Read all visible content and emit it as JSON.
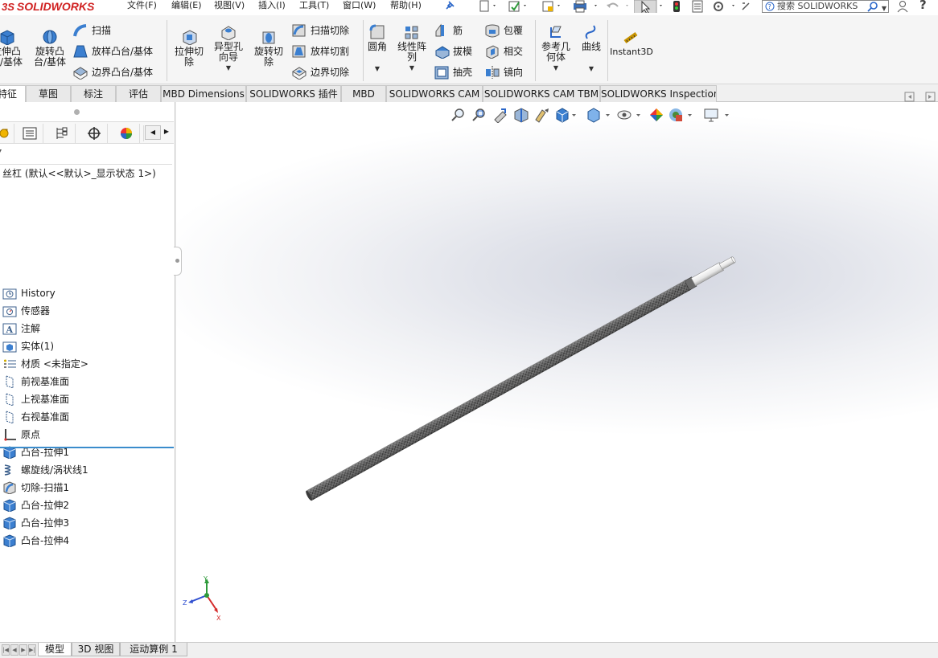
{
  "app": {
    "brand": "SOLIDWORKS",
    "brand_prefix": "3S"
  },
  "menu": [
    {
      "label": "文件(F)"
    },
    {
      "label": "编辑(E)"
    },
    {
      "label": "视图(V)"
    },
    {
      "label": "插入(I)"
    },
    {
      "label": "工具(T)"
    },
    {
      "label": "窗口(W)"
    },
    {
      "label": "帮助(H)"
    }
  ],
  "search": {
    "placeholder": "搜索 SOLIDWORKS"
  },
  "ribbon": {
    "extrude_boss": "拉伸凸\n台/基体",
    "revolve_boss": "旋转凸\n台/基体",
    "sweep": "扫描",
    "loft_boss": "放样凸台/基体",
    "boundary_boss": "边界凸台/基体",
    "extrude_cut": "拉伸切\n除",
    "hole_wizard": "异型孔\n向导",
    "revolve_cut": "旋转切\n除",
    "swept_cut": "扫描切除",
    "lofted_cut": "放样切割",
    "boundary_cut": "边界切除",
    "fillet": "圆角",
    "linear_pattern": "线性阵\n列",
    "rib": "筋",
    "draft": "拔模",
    "shell": "抽壳",
    "wrap": "包覆",
    "intersect": "相交",
    "mirror": "镜向",
    "ref_geometry": "参考几\n何体",
    "curves": "曲线",
    "instant3d": "Instant3D"
  },
  "tabs": [
    {
      "label": "特征",
      "active": true
    },
    {
      "label": "草图"
    },
    {
      "label": "标注"
    },
    {
      "label": "评估"
    },
    {
      "label": "MBD Dimensions"
    },
    {
      "label": "SOLIDWORKS 插件"
    },
    {
      "label": "MBD"
    },
    {
      "label": "SOLIDWORKS CAM"
    },
    {
      "label": "SOLIDWORKS CAM TBM"
    },
    {
      "label": "SOLIDWORKS Inspection"
    }
  ],
  "tree": {
    "root": "丝杠  (默认<<默认>_显示状态 1>)",
    "items": [
      {
        "label": "History",
        "icon": "history-folder-icon"
      },
      {
        "label": "传感器",
        "icon": "sensor-icon"
      },
      {
        "label": "注解",
        "icon": "annotation-icon"
      },
      {
        "label": "实体(1)",
        "icon": "solid-bodies-icon"
      },
      {
        "label": "材质 <未指定>",
        "icon": "material-icon"
      },
      {
        "label": "前视基准面",
        "icon": "plane-icon"
      },
      {
        "label": "上视基准面",
        "icon": "plane-icon"
      },
      {
        "label": "右视基准面",
        "icon": "plane-icon"
      },
      {
        "label": "原点",
        "icon": "origin-icon"
      },
      {
        "label": "凸台-拉伸1",
        "icon": "boss-extrude-icon"
      },
      {
        "label": "螺旋线/涡状线1",
        "icon": "helix-icon"
      },
      {
        "label": "切除-扫描1",
        "icon": "cut-sweep-icon"
      },
      {
        "label": "凸台-拉伸2",
        "icon": "boss-extrude-icon"
      },
      {
        "label": "凸台-拉伸3",
        "icon": "boss-extrude-icon"
      },
      {
        "label": "凸台-拉伸4",
        "icon": "boss-extrude-icon"
      }
    ]
  },
  "triad": {
    "x": "X",
    "y": "Y",
    "z": "Z"
  },
  "bottom_tabs": [
    {
      "label": "模型",
      "active": true
    },
    {
      "label": "3D 视图"
    },
    {
      "label": "运动算例 1"
    }
  ],
  "colors": {
    "brand_red": "#d02020",
    "rollback_bar": "#3a8ccc",
    "triad_x": "#d42a2a",
    "triad_y": "#2e9a3a",
    "triad_z": "#2f4fd0"
  }
}
